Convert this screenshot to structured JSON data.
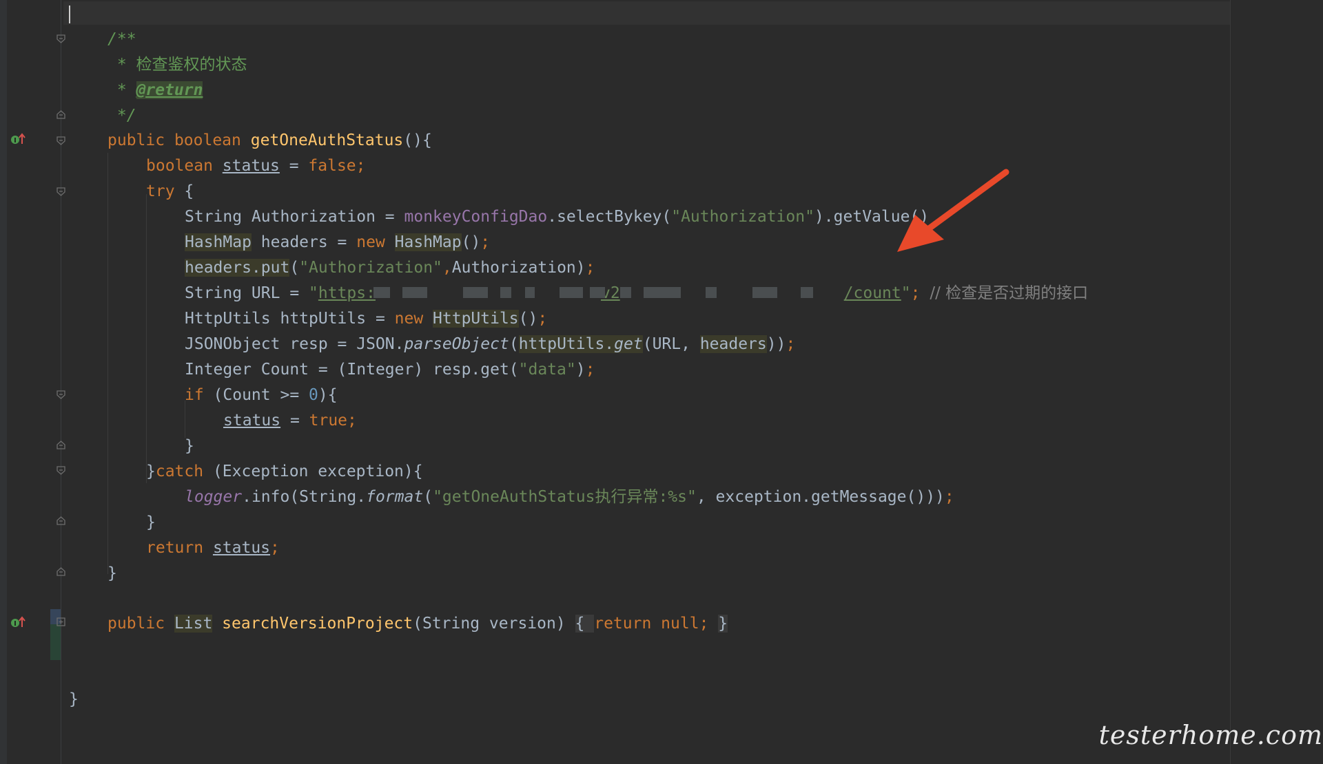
{
  "editor": {
    "colors": {
      "background": "#2b2b2b",
      "keyword": "#cc7832",
      "string": "#6a8759",
      "method": "#ffc66d",
      "field": "#9876aa",
      "comment": "#629755",
      "number": "#6897bb",
      "annotation_arrow": "#e8492a"
    }
  },
  "code": {
    "l1": "/**",
    "l2_star": " * ",
    "l2_text": "检查鉴权的状态",
    "l3_star": " * ",
    "l3_tag": "@return",
    "l4": " */",
    "l5_public": "public ",
    "l5_type": "boolean ",
    "l5_name": "getOneAuthStatus",
    "l5_rest": "(){",
    "l6_type": "boolean ",
    "l6_var": "status",
    "l6_eq": " = ",
    "l6_val": "false",
    "l6_semi": ";",
    "l7_try": "try",
    "l7_brace": " {",
    "l8_a": "String Authorization = ",
    "l8_dao": "monkeyConfigDao",
    "l8_b": ".selectBykey(",
    "l8_str": "\"Authorization\"",
    "l8_c": ").getValue()",
    "l9_type": "HashMap",
    "l9_a": " headers = ",
    "l9_new": "new ",
    "l9_type2": "HashMap",
    "l9_b": "()",
    "l9_semi": ";",
    "l10_a": "headers.put",
    "l10_b": "(",
    "l10_str": "\"Authorization\"",
    "l10_comma": ",",
    "l10_c": "Authorization)",
    "l10_semi": ";",
    "l11_a": "String URL = ",
    "l11_q1": "\"",
    "l11_https": "https:",
    "l11_v": "v2",
    "l11_count": "/count",
    "l11_q2": "\"",
    "l11_semi": "; ",
    "l11_cmt": "// ",
    "l11_cmt_text": "检查是否过期的接口",
    "l12_a": "HttpUtils httpUtils = ",
    "l12_new": "new ",
    "l12_type": "HttpUtils",
    "l12_b": "()",
    "l12_semi": ";",
    "l13_a": "JSONObject resp = JSON.",
    "l13_parse": "parseObject",
    "l13_b": "(",
    "l13_hu": "httpUtils.",
    "l13_get": "get",
    "l13_c": "(URL, ",
    "l13_headers": "headers",
    "l13_d": "))",
    "l13_semi": ";",
    "l14_a": "Integer Count = (Integer) resp.get(",
    "l14_str": "\"data\"",
    "l14_b": ")",
    "l14_semi": ";",
    "l15_if": "if ",
    "l15_a": "(Count >= ",
    "l15_num": "0",
    "l15_b": "){",
    "l16_var": "status",
    "l16_eq": " = ",
    "l16_val": "true",
    "l16_semi": ";",
    "l17": "}",
    "l18_brace": "}",
    "l18_catch": "catch ",
    "l18_a": "(Exception exception){",
    "l19_logger": "logger",
    "l19_a": ".info(String.",
    "l19_format": "format",
    "l19_b": "(",
    "l19_str": "\"getOneAuthStatus执行异常:%s\"",
    "l19_c": ", exception.getMessage()))",
    "l19_semi": ";",
    "l20": "}",
    "l21_return": "return ",
    "l21_var": "status",
    "l21_semi": ";",
    "l22": "}",
    "l24_public": "public ",
    "l24_type": "List",
    "l24_name": " searchVersionProject",
    "l24_a": "(String version) ",
    "l24_fold1": "{ ",
    "l24_return": "return ",
    "l24_null": "null",
    "l24_semi": "; ",
    "l24_fold2": "}",
    "l27": "}"
  },
  "watermark": "testerhome.com"
}
